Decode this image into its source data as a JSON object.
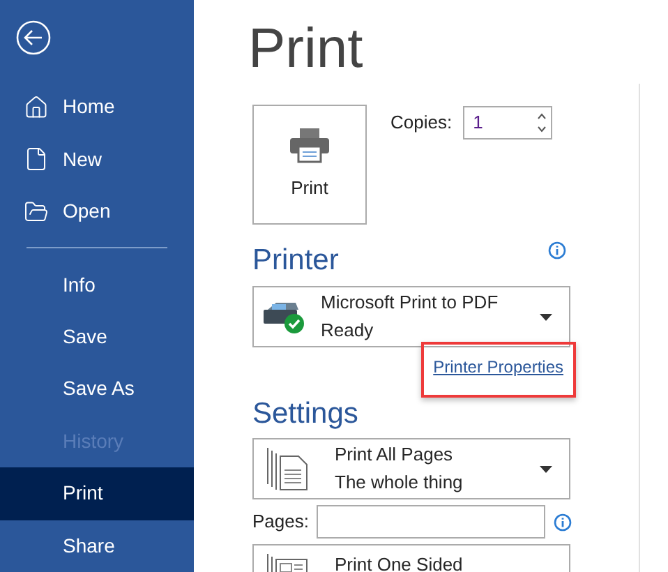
{
  "sidebar": {
    "items": [
      {
        "label": "Home",
        "kind": "home",
        "selected": false,
        "disabled": false
      },
      {
        "label": "New",
        "kind": "new",
        "selected": false,
        "disabled": false
      },
      {
        "label": "Open",
        "kind": "open",
        "selected": false,
        "disabled": false
      },
      {
        "label": "Info",
        "kind": "plain",
        "selected": false,
        "disabled": false
      },
      {
        "label": "Save",
        "kind": "plain",
        "selected": false,
        "disabled": false
      },
      {
        "label": "Save As",
        "kind": "plain",
        "selected": false,
        "disabled": false
      },
      {
        "label": "History",
        "kind": "plain",
        "selected": false,
        "disabled": true
      },
      {
        "label": "Print",
        "kind": "plain",
        "selected": true,
        "disabled": false
      },
      {
        "label": "Share",
        "kind": "plain",
        "selected": false,
        "disabled": false
      }
    ]
  },
  "title": "Print",
  "print_button": {
    "label": "Print"
  },
  "copies": {
    "label": "Copies:",
    "value": "1"
  },
  "printer": {
    "heading": "Printer",
    "name": "Microsoft Print to PDF",
    "status": "Ready",
    "properties_link": "Printer Properties",
    "highlighted": true
  },
  "settings": {
    "heading": "Settings",
    "dropdowns": [
      {
        "kind": "pages",
        "line1": "Print All Pages",
        "line2": "The whole thing"
      }
    ],
    "pages": {
      "label": "Pages:"
    },
    "sides": {
      "kind": "sides",
      "line1": "Print One Sided"
    }
  }
}
